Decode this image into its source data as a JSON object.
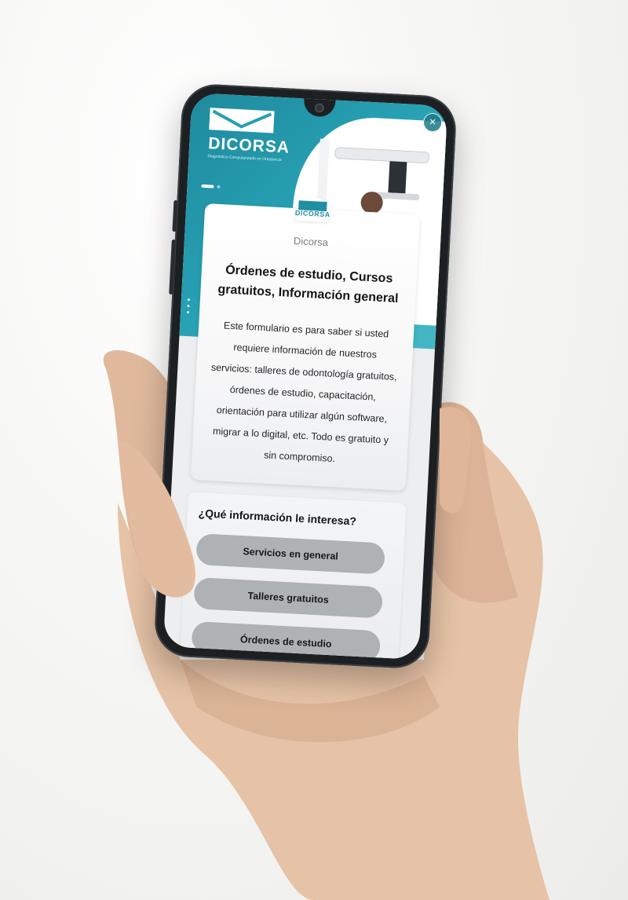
{
  "header": {
    "logo_name": "DICORSA",
    "logo_tagline": "Diagnóstico Computarizado en Ortodoncia",
    "close_label": "×"
  },
  "card": {
    "mini_logo": "DICORSA",
    "brand": "Dicorsa",
    "title": "Órdenes de estudio, Cursos gratuitos, Información general",
    "description": "Este formulario es para saber si usted requiere información de nuestros servicios: talleres de odontología gratuitos, órdenes de estudio, capacitación, orientación para utilizar algún software, migrar a lo digital, etc. Todo es gratuito y sin compromiso."
  },
  "question": {
    "title": "¿Qué información le interesa?",
    "options": [
      {
        "label": "Servicios en general"
      },
      {
        "label": "Talleres gratuitos"
      },
      {
        "label": "Órdenes de estudio"
      }
    ]
  },
  "colors": {
    "brand_teal": "#27a0b3",
    "option_bg": "#aeb2b5"
  },
  "icons": [
    "close-icon",
    "dicorsa-logo",
    "carousel-dots"
  ]
}
